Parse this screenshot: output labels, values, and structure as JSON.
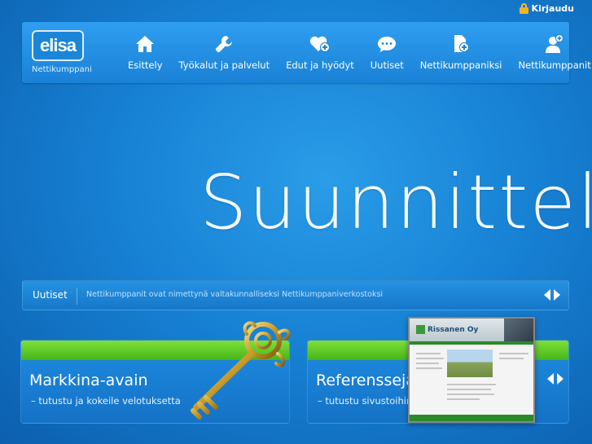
{
  "login": {
    "label": "Kirjaudu"
  },
  "header": {
    "logo_text": "elisa",
    "logo_sub": "Nettikumppani",
    "nav": [
      {
        "label": "Esittely",
        "icon": "home-icon"
      },
      {
        "label": "Työkalut ja palvelut",
        "icon": "wrench-icon"
      },
      {
        "label": "Edut ja hyödyt",
        "icon": "heart-plus-icon"
      },
      {
        "label": "Uutiset",
        "icon": "chat-bubble-icon"
      },
      {
        "label": "Nettikumppaniksi",
        "icon": "document-plus-icon"
      },
      {
        "label": "Nettikumppanit",
        "icon": "person-plus-icon"
      }
    ]
  },
  "hero": {
    "text": "Suunnittel"
  },
  "news": {
    "label": "Uutiset",
    "text": "Nettikumppanit ovat nimettynä valtakunnalliseksi Nettikumppaniverkostoksi"
  },
  "cards": [
    {
      "title": "Markkina-avain",
      "subtitle": "– tutustu ja kokeile velotuksetta"
    },
    {
      "title": "Referenssejä",
      "subtitle": "– tutustu sivustoihin"
    }
  ],
  "thumbnail": {
    "brand": "Rissanen Oy"
  },
  "colors": {
    "accent_green": "#58c422",
    "brand_blue": "#1a82d6",
    "lock_gold": "#f2b21e"
  }
}
